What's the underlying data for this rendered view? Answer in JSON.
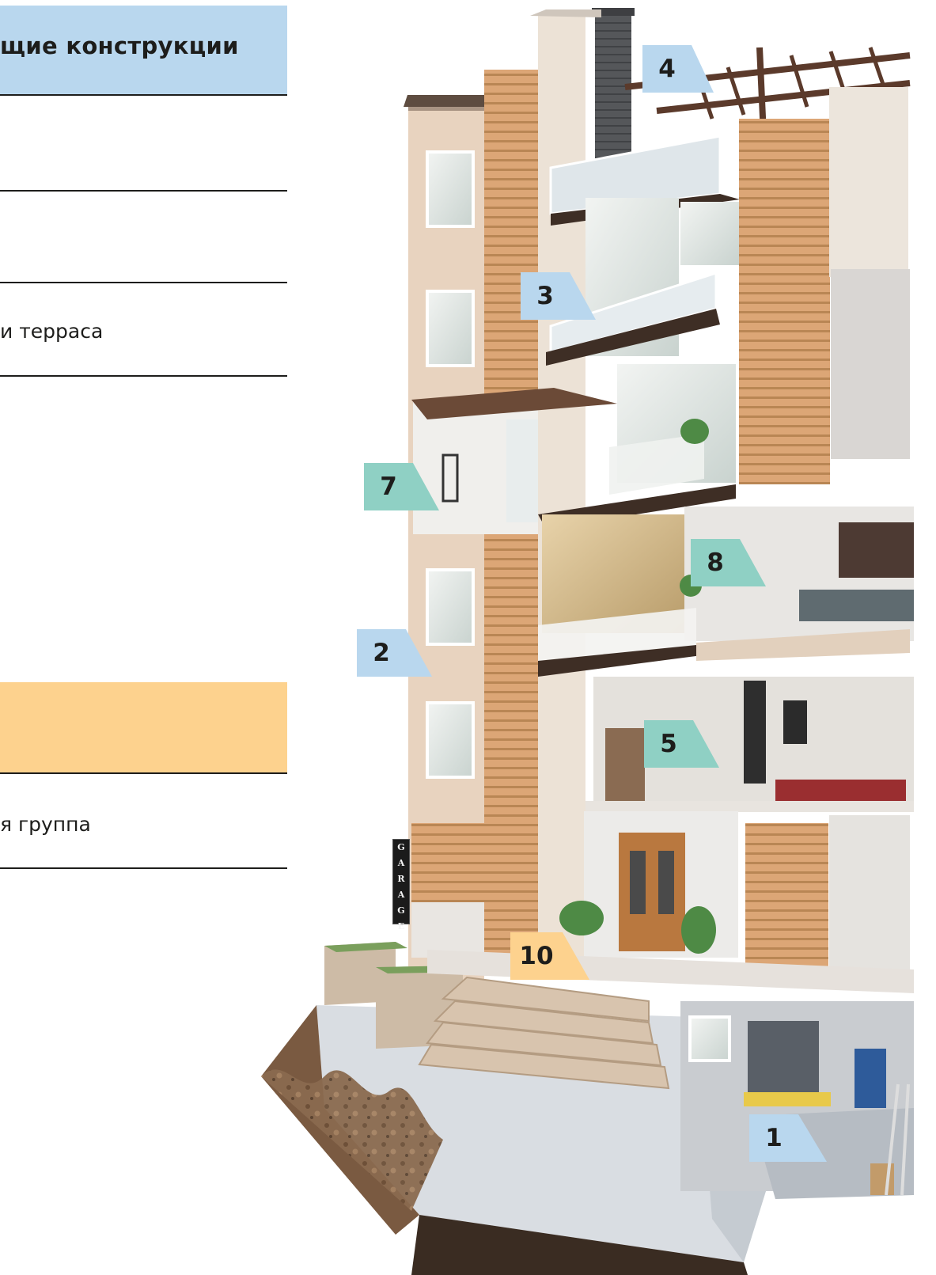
{
  "header": {
    "title": "щие конструкции",
    "color": "#b9d7ee"
  },
  "section2": {
    "color": "#fdd28e"
  },
  "rows": {
    "terrace": "и терраса",
    "entrance": "я группа"
  },
  "markers": [
    {
      "label": "4",
      "color": "#b9d7ee"
    },
    {
      "label": "3",
      "color": "#b9d7ee"
    },
    {
      "label": "7",
      "color": "#8fd0c4"
    },
    {
      "label": "8",
      "color": "#8fd0c4"
    },
    {
      "label": "2",
      "color": "#b9d7ee"
    },
    {
      "label": "5",
      "color": "#8fd0c4"
    },
    {
      "label": "10",
      "color": "#fdd28e"
    },
    {
      "label": "1",
      "color": "#b9d7ee"
    }
  ],
  "garage_sign": {
    "letters": [
      "G",
      "A",
      "R",
      "A",
      "G",
      "E"
    ]
  }
}
